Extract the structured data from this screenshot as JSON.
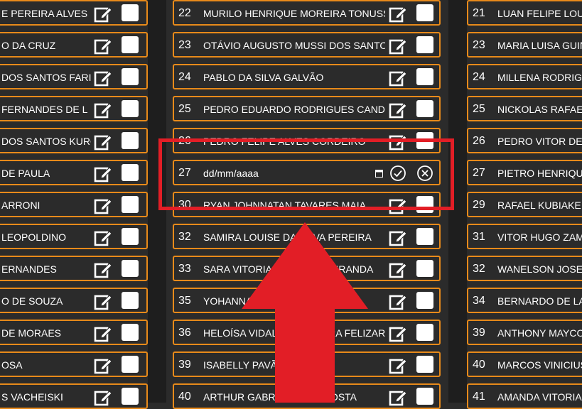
{
  "left_column": [
    {
      "name": "E PEREIRA ALVES"
    },
    {
      "name": "O DA CRUZ"
    },
    {
      "name": "DOS SANTOS FARI"
    },
    {
      "name": "FERNANDES DE L"
    },
    {
      "name": "DOS SANTOS KURO"
    },
    {
      "name": "DE PAULA"
    },
    {
      "name": "ARRONI"
    },
    {
      "name": "LEOPOLDINO"
    },
    {
      "name": "ERNANDES"
    },
    {
      "name": "O DE SOUZA"
    },
    {
      "name": "DE MORAES"
    },
    {
      "name": "OSA"
    },
    {
      "name": "S VACHEISKI"
    }
  ],
  "middle_column": [
    {
      "num": "22",
      "name": "MURILO HENRIQUE MOREIRA TONUSSI"
    },
    {
      "num": "23",
      "name": "OTÁVIO AUGUSTO MUSSI DOS SANTOS"
    },
    {
      "num": "24",
      "name": "PABLO DA SILVA GALVÃO"
    },
    {
      "num": "25",
      "name": "PEDRO EDUARDO RODRIGUES CAND"
    },
    {
      "num": "26",
      "name": "PEDRO FELIPE ALVES CORDEIRO"
    },
    {
      "num": "30",
      "name": "RYAN JOHNNATAN TAVARES MAIA"
    },
    {
      "num": "32",
      "name": "SAMIRA LOUISE DA SILVA PEREIRA"
    },
    {
      "num": "33",
      "name": "SARA VITORIA DE ABREU MIRANDA"
    },
    {
      "num": "35",
      "name": "YOHANNA DE OLIVEIRA LIMA"
    },
    {
      "num": "36",
      "name": "HELOÍSA VIDAL DE OLIVEIRA FELIZARDO"
    },
    {
      "num": "39",
      "name": "ISABELLY PAVÃO"
    },
    {
      "num": "40",
      "name": "ARTHUR GABRIEL LEITE COSTA"
    }
  ],
  "edit_row": {
    "num": "27",
    "date_placeholder": "dd/mm/aaaa"
  },
  "right_column": [
    {
      "num": "21",
      "name": "LUAN FELIPE LOU"
    },
    {
      "num": "23",
      "name": "MARIA LUISA GUIN"
    },
    {
      "num": "24",
      "name": "MILLENA RODRIGU"
    },
    {
      "num": "25",
      "name": "NICKOLAS RAFAEL"
    },
    {
      "num": "26",
      "name": "PEDRO VITOR DE"
    },
    {
      "num": "27",
      "name": "PIETRO HENRIQU"
    },
    {
      "num": "29",
      "name": "RAFAEL KUBIAKE"
    },
    {
      "num": "31",
      "name": "VITOR HUGO ZAM"
    },
    {
      "num": "32",
      "name": "WANELSON JOSE"
    },
    {
      "num": "34",
      "name": "BERNARDO DE LA"
    },
    {
      "num": "39",
      "name": "ANTHONY MAYCO"
    },
    {
      "num": "40",
      "name": "MARCOS VINICIUS"
    },
    {
      "num": "41",
      "name": "AMANDA VITORIA"
    }
  ],
  "colors": {
    "border": "#e88a1a",
    "highlight": "#e21e26",
    "background": "#2b2b2b"
  }
}
